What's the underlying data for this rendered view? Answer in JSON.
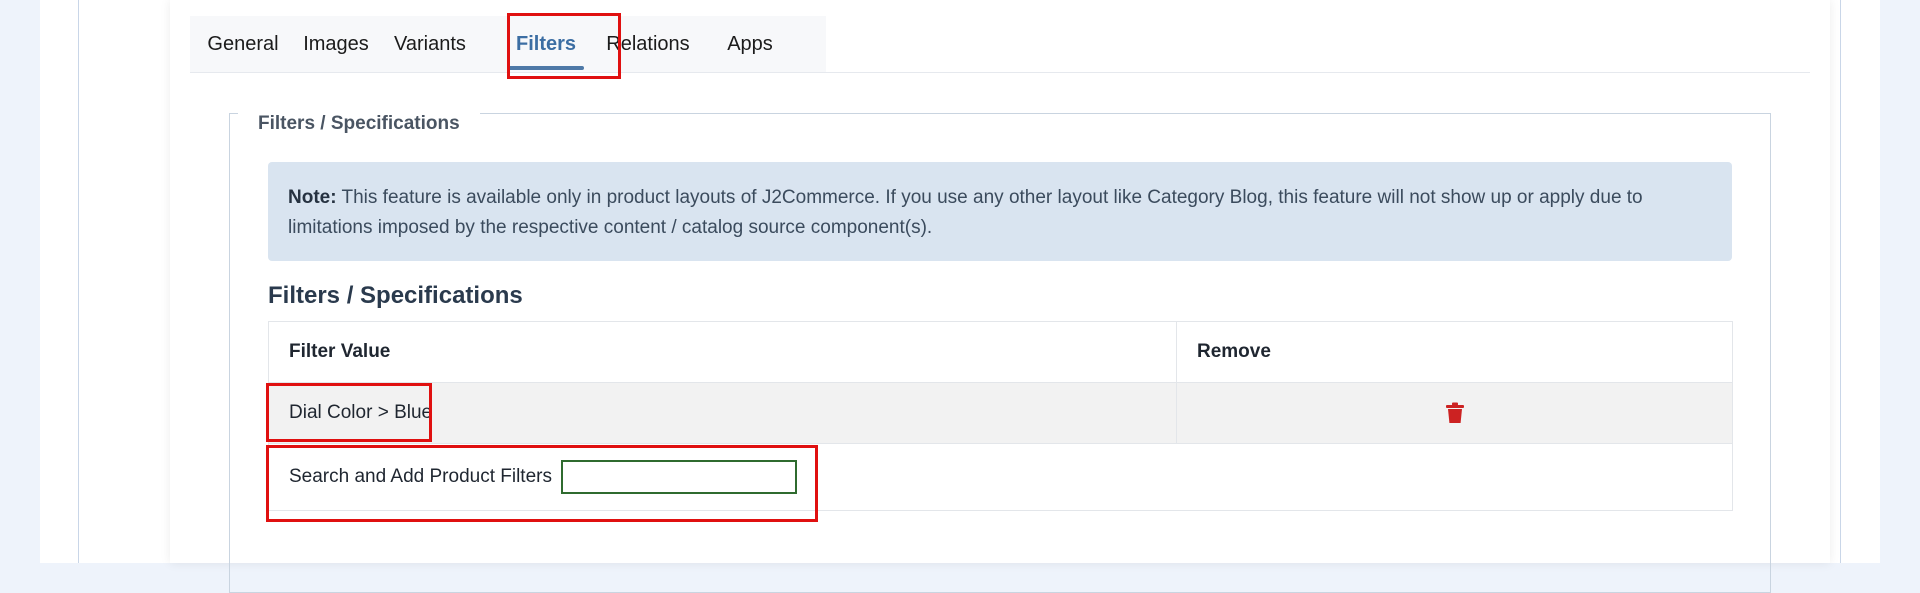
{
  "tabs": [
    {
      "label": "General"
    },
    {
      "label": "Images"
    },
    {
      "label": "Variants"
    },
    {
      "label": "Filters",
      "active": true
    },
    {
      "label": "Relations"
    },
    {
      "label": "Apps"
    }
  ],
  "section": {
    "legend": "Filters / Specifications",
    "note": {
      "label": "Note:",
      "text": "This feature is available only in product layouts of J2Commerce. If you use any other layout like Category Blog, this feature will not show up or apply due to limitations imposed by the respective content / catalog source component(s)."
    },
    "heading": "Filters / Specifications"
  },
  "table": {
    "headers": {
      "value": "Filter Value",
      "remove": "Remove"
    },
    "rows": [
      {
        "value": "Dial Color > Blue",
        "remove_icon": "trash-icon"
      }
    ],
    "add": {
      "label": "Search and Add Product Filters",
      "value": "",
      "placeholder": ""
    }
  },
  "colors": {
    "active_tab": "#3c6ea3",
    "highlight": "#e01010",
    "note_bg": "#d9e4f0",
    "trash": "#cc2222"
  }
}
